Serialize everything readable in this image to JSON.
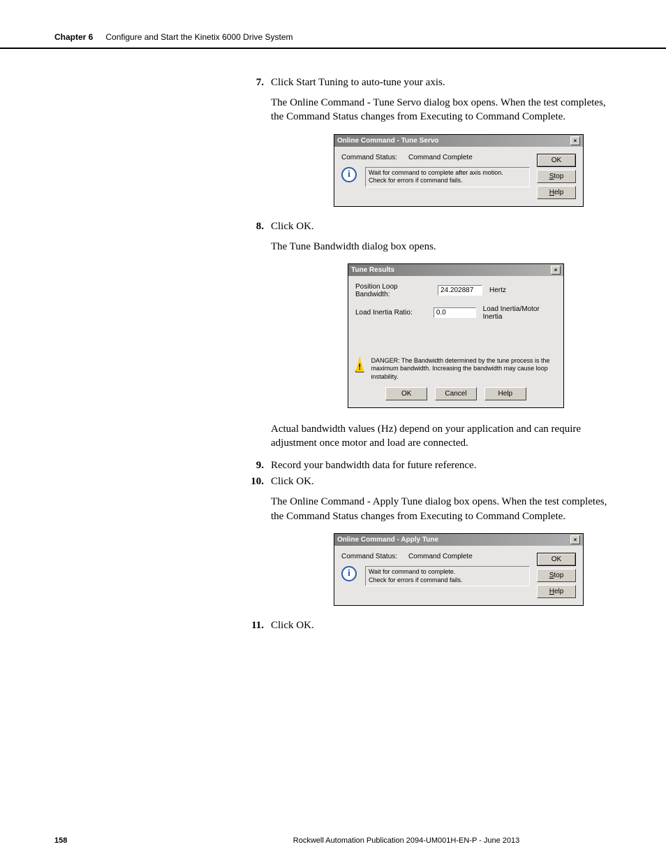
{
  "header": {
    "chapter_label": "Chapter 6",
    "chapter_title": "Configure and Start the Kinetix 6000 Drive System"
  },
  "steps": {
    "s7": {
      "num": "7.",
      "text": "Click Start Tuning to auto-tune your axis."
    },
    "p7": "The Online Command - Tune Servo dialog box opens. When the test completes, the Command Status changes from Executing to Command Complete.",
    "s8": {
      "num": "8.",
      "text": "Click OK."
    },
    "p8": "The Tune Bandwidth dialog box opens.",
    "p8b": "Actual bandwidth values (Hz) depend on your application and can require adjustment once motor and load are connected.",
    "s9": {
      "num": "9.",
      "text": "Record your bandwidth data for future reference."
    },
    "s10": {
      "num": "10.",
      "text": "Click OK."
    },
    "p10": "The Online Command - Apply Tune dialog box opens. When the test completes, the Command Status changes from Executing to Command Complete.",
    "s11": {
      "num": "11.",
      "text": "Click OK."
    }
  },
  "dlg_tune_servo": {
    "title": "Online Command - Tune Servo",
    "status_label": "Command Status:",
    "status_value": "Command Complete",
    "info": "Wait for command to complete after axis motion.\nCheck for errors if command fails.",
    "ok": "OK",
    "stop": "Stop",
    "help": "Help"
  },
  "dlg_tune_results": {
    "title": "Tune Results",
    "pos_label": "Position Loop Bandwidth:",
    "pos_value": "24.202887",
    "pos_unit": "Hertz",
    "ratio_label": "Load Inertia Ratio:",
    "ratio_value": "0.0",
    "ratio_unit": "Load Inertia/Motor Inertia",
    "danger": "DANGER: The Bandwidth determined by the tune process is the maximum bandwidth. Increasing the bandwidth may cause loop instability.",
    "ok": "OK",
    "cancel": "Cancel",
    "help": "Help"
  },
  "dlg_apply_tune": {
    "title": "Online Command - Apply Tune",
    "status_label": "Command Status:",
    "status_value": "Command Complete",
    "info": "Wait for command to complete.\nCheck for errors if command fails.",
    "ok": "OK",
    "stop": "Stop",
    "help": "Help"
  },
  "footer": {
    "page": "158",
    "pub": "Rockwell Automation Publication 2094-UM001H-EN-P - June 2013"
  },
  "chart_data": {
    "type": "table",
    "title": "Tune Results",
    "rows": [
      {
        "field": "Position Loop Bandwidth",
        "value": 24.202887,
        "unit": "Hertz"
      },
      {
        "field": "Load Inertia Ratio",
        "value": 0.0,
        "unit": "Load Inertia/Motor Inertia"
      }
    ]
  }
}
